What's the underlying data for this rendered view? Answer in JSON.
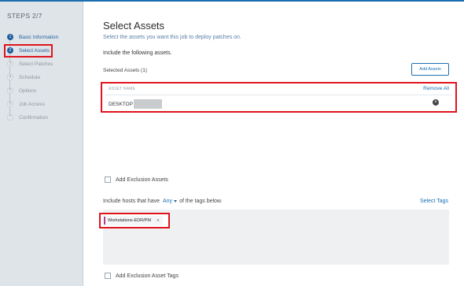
{
  "sidebar": {
    "title": "STEPS 2/7",
    "steps": [
      {
        "num": "1",
        "label": "Basic Information",
        "state": "done"
      },
      {
        "num": "2",
        "label": "Select Assets",
        "state": "active"
      },
      {
        "num": "3",
        "label": "Select Patches",
        "state": "pending"
      },
      {
        "num": "4",
        "label": "Schedule",
        "state": "pending"
      },
      {
        "num": "5",
        "label": "Options",
        "state": "pending"
      },
      {
        "num": "6",
        "label": "Job Access",
        "state": "pending"
      },
      {
        "num": "7",
        "label": "Confirmation",
        "state": "pending"
      }
    ]
  },
  "main": {
    "title": "Select Assets",
    "subtitle": "Select the assets you want this job to deploy patches on.",
    "include_label": "Include the following assets.",
    "selected_count": "Selected Assets (1)",
    "add_assets_label": "Add Assets",
    "assets_table": {
      "column_header": "ASSET NAME",
      "remove_all_label": "Remove All",
      "rows": [
        {
          "name": "DESKTOP"
        }
      ]
    },
    "add_exclusion_assets_label": "Add Exclusion Assets",
    "hosts_prefix": "Include hosts that have",
    "hosts_match": "Any",
    "hosts_suffix": "of the tags below.",
    "select_tags_label": "Select Tags",
    "tags": [
      {
        "label": "Workstations-EDR/PM",
        "color": "#b43c8c"
      }
    ],
    "add_exclusion_tags_label": "Add Exclusion Asset Tags"
  },
  "colors": {
    "accent": "#1a6fb3",
    "highlight": "#e0141e",
    "sidebar_bg": "#dfe4e8"
  }
}
